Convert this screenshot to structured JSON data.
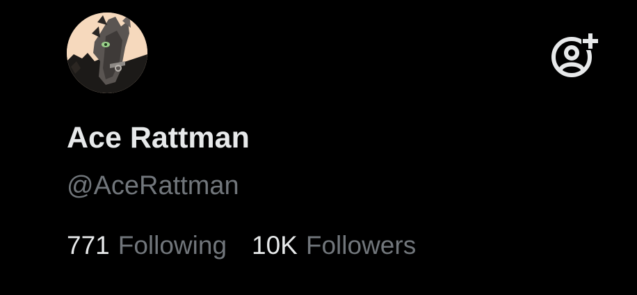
{
  "profile": {
    "display_name": "Ace Rattman",
    "handle": "@AceRattman",
    "following_count": "771",
    "following_label": "Following",
    "followers_count": "10K",
    "followers_label": "Followers"
  },
  "icons": {
    "avatar": "horse-portrait-avatar",
    "add_friend": "add-person-icon"
  },
  "colors": {
    "background": "#000000",
    "primary_text": "#e7e9ea",
    "secondary_text": "#71767b",
    "avatar_bg": "#f6d9bd"
  }
}
